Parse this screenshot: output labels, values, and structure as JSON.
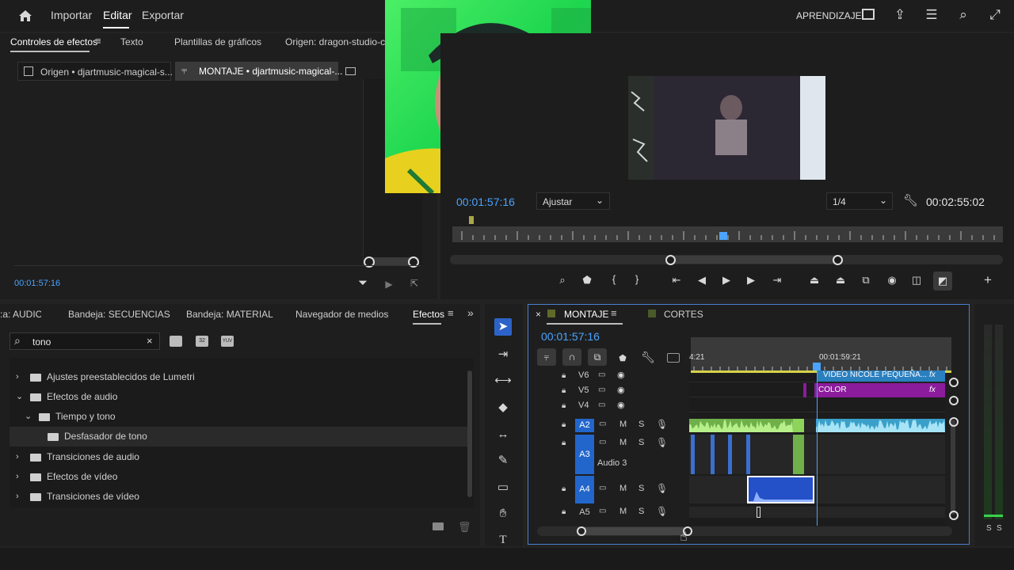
{
  "menu": {
    "items": [
      "Importar",
      "Editar",
      "Exportar"
    ],
    "right_label": "APRENDIZAJE"
  },
  "effect_controls": {
    "tabs": [
      "Controles de efectos",
      "Texto",
      "Plantillas de gráficos",
      "Origen: dragon-studio-clea"
    ],
    "subtabs": [
      "Origen • djartmusic-magical-s...",
      "MONTAJE • djartmusic-magical-..."
    ],
    "timecode": "00:01:57:16"
  },
  "program_monitor": {
    "timecode": "00:01:57:16",
    "fit_label": "Ajustar",
    "resolution": "1/4",
    "duration": "00:02:55:02",
    "buttons": {
      "mark_in": "{",
      "mark_out": "}"
    }
  },
  "project_panel": {
    "tabs": [
      ":a: AUDIO",
      "Bandeja: SECUENCIAS",
      "Bandeja: MATERIAL",
      "Navegador de medios",
      "Efectos"
    ],
    "search_value": "tono",
    "tree": [
      {
        "label": "Ajustes preestablecidos de Lumetri",
        "level": 0,
        "expanded": false
      },
      {
        "label": "Efectos de audio",
        "level": 0,
        "expanded": true
      },
      {
        "label": "Tiempo y tono",
        "level": 1,
        "expanded": true
      },
      {
        "label": "Desfasador de tono",
        "level": 2,
        "expanded": false
      },
      {
        "label": "Transiciones de audio",
        "level": 0,
        "expanded": false
      },
      {
        "label": "Efectos de vídeo",
        "level": 0,
        "expanded": false
      },
      {
        "label": "Transiciones de vídeo",
        "level": 0,
        "expanded": false
      }
    ]
  },
  "timeline": {
    "tabs": [
      "MONTAJE",
      "CORTES"
    ],
    "close_label": "×",
    "timecode": "00:01:57:16",
    "ruler_left": "4:21",
    "ruler_mid": "00:01:59:21",
    "video_tracks": [
      {
        "id": "V6"
      },
      {
        "id": "V5"
      },
      {
        "id": "V4"
      }
    ],
    "audio_tracks": [
      {
        "id": "A2",
        "name": ""
      },
      {
        "id": "A3",
        "name": "Audio 3"
      },
      {
        "id": "A4",
        "name": ""
      },
      {
        "id": "A5",
        "name": ""
      }
    ],
    "clip_labels": {
      "v6": "VIDEO NICOLE PEQUEÑA...",
      "v5": "COLOR",
      "fx": "fx"
    },
    "track_buttons": {
      "m": "M",
      "s": "S"
    }
  },
  "meter": {
    "labels": [
      "S",
      "S"
    ]
  }
}
